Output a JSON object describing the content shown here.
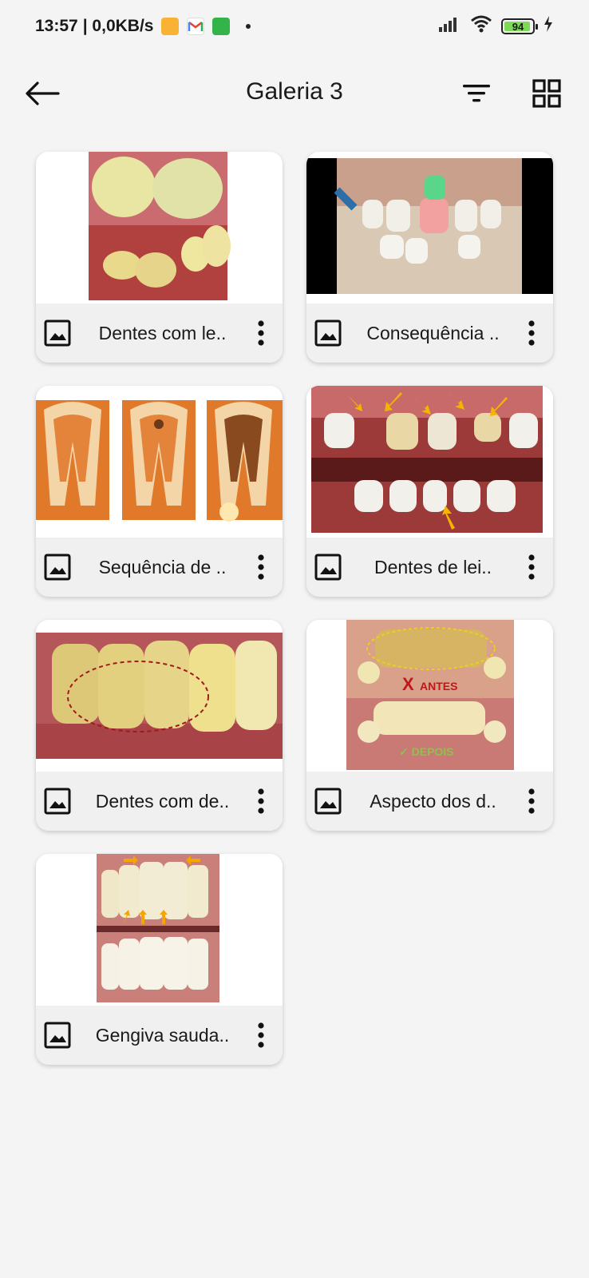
{
  "status": {
    "time": "13:57",
    "network": "| 0,0KB/s",
    "battery": "94"
  },
  "header": {
    "title": "Galeria 3"
  },
  "gallery": {
    "items": [
      {
        "label": "Dentes com le.."
      },
      {
        "label": "Consequência .."
      },
      {
        "label": "Sequência de .."
      },
      {
        "label": "Dentes de lei.."
      },
      {
        "label": "Dentes com de.."
      },
      {
        "label": "Aspecto dos d.."
      },
      {
        "label": "Gengiva sauda.."
      }
    ],
    "overlays": {
      "antes": "ANTES",
      "depois": "✓ DEPOIS",
      "x_mark": "X"
    }
  },
  "colors": {
    "background": "#f4f4f4",
    "card": "#ffffff",
    "card_footer": "#f0f0f0",
    "battery_fill": "#7ed957"
  }
}
